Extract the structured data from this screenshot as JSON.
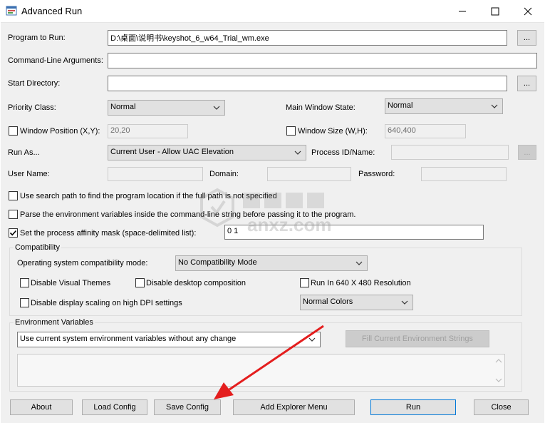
{
  "window": {
    "title": "Advanced Run"
  },
  "fields": {
    "program_label": "Program to Run:",
    "program_value": "D:\\桌面\\说明书\\keyshot_6_w64_Trial_wm.exe",
    "cmdargs_label": "Command-Line Arguments:",
    "cmdargs_value": "",
    "startdir_label": "Start Directory:",
    "startdir_value": "",
    "browse_label": "...",
    "priority_label": "Priority Class:",
    "priority_value": "Normal",
    "mainwin_label": "Main Window State:",
    "mainwin_value": "Normal",
    "winpos_label": "Window Position (X,Y):",
    "winpos_value": "20,20",
    "winsize_label": "Window Size (W,H):",
    "winsize_value": "640,400",
    "runas_label": "Run As...",
    "runas_value": "Current User - Allow UAC Elevation",
    "pid_label": "Process ID/Name:",
    "username_label": "User Name:",
    "domain_label": "Domain:",
    "password_label": "Password:",
    "search_path_label": "Use search path to find the program location if the full path is not specified",
    "parse_env_label": "Parse the environment variables inside the command-line string before passing it to the program.",
    "affinity_label": "Set the process affinity mask (space-delimited list):",
    "affinity_value": "0 1"
  },
  "compat": {
    "group_label": "Compatibility",
    "os_mode_label": "Operating system compatibility mode:",
    "os_mode_value": "No Compatibility Mode",
    "visual_themes": "Disable Visual Themes",
    "desktop_comp": "Disable desktop composition",
    "res_640": "Run In 640 X 480 Resolution",
    "dpi_scaling": "Disable display scaling on high DPI settings",
    "colors_value": "Normal Colors"
  },
  "env": {
    "group_label": "Environment Variables",
    "mode_value": "Use current system environment variables without any change",
    "fill_button": "Fill Current Environment Strings"
  },
  "buttons": {
    "about": "About",
    "load": "Load Config",
    "save": "Save Config",
    "explorer": "Add Explorer Menu",
    "run": "Run",
    "close": "Close"
  },
  "watermark": {
    "text": "anxz.com"
  }
}
